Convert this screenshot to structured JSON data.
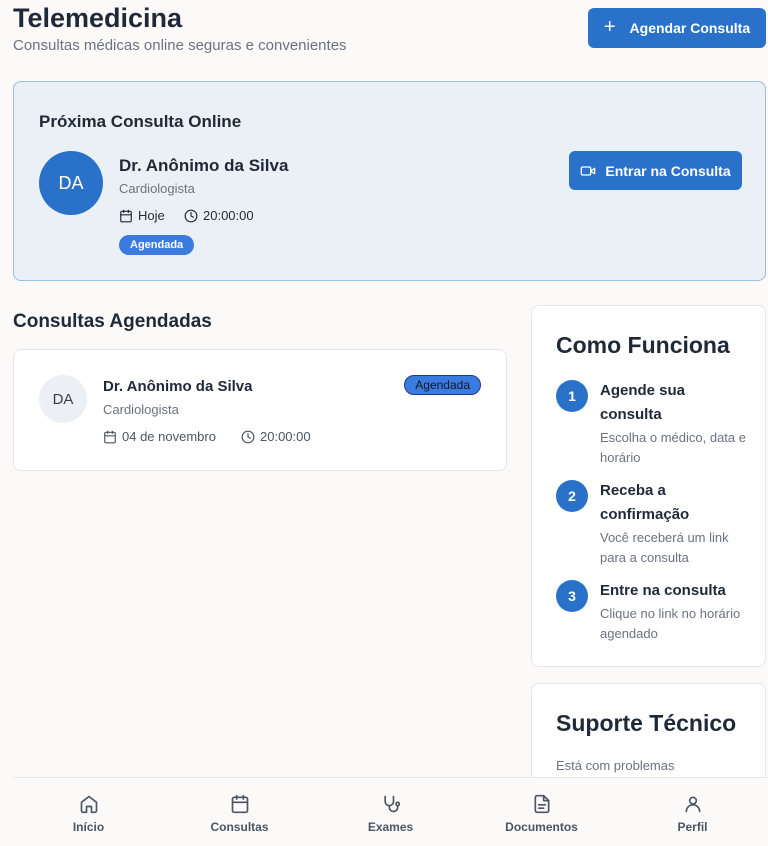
{
  "header": {
    "title": "Telemedicina",
    "subtitle": "Consultas médicas online seguras e convenientes",
    "schedule_button": "Agendar Consulta",
    "schedule_icon": "plus-icon"
  },
  "next_consult": {
    "title": "Próxima Consulta Online",
    "avatar_initials": "DA",
    "doctor_name": "Dr. Anônimo da Silva",
    "specialty": "Cardiologista",
    "date": "Hoje",
    "time": "20:00:00",
    "status": "Agendada",
    "enter_button": "Entrar na Consulta",
    "enter_icon": "video-icon"
  },
  "scheduled": {
    "title": "Consultas Agendadas",
    "items": [
      {
        "avatar_initials": "DA",
        "doctor_name": "Dr. Anônimo da Silva",
        "specialty": "Cardiologista",
        "date": "04 de novembro",
        "time": "20:00:00",
        "status": "Agendada"
      }
    ]
  },
  "how_it_works": {
    "title": "Como Funciona",
    "steps": [
      {
        "number": "1",
        "title": "Agende sua consulta",
        "description": "Escolha o médico, data e horário"
      },
      {
        "number": "2",
        "title": "Receba a confirmação",
        "description": "Você receberá um link para a consulta"
      },
      {
        "number": "3",
        "title": "Entre na consulta",
        "description": "Clique no link no horário agendado"
      }
    ]
  },
  "support": {
    "title": "Suporte Técnico",
    "text": "Está com problemas"
  },
  "bottom_nav": {
    "items": [
      {
        "label": "Início",
        "icon": "home-icon"
      },
      {
        "label": "Consultas",
        "icon": "calendar-icon"
      },
      {
        "label": "Exames",
        "icon": "stethoscope-icon"
      },
      {
        "label": "Documentos",
        "icon": "document-icon"
      },
      {
        "label": "Perfil",
        "icon": "user-icon"
      }
    ]
  },
  "colors": {
    "primary": "#2a72c9",
    "badge": "#3b7be0",
    "card_highlight_bg": "#ebf0f6",
    "card_highlight_border": "#9bbfe3"
  }
}
